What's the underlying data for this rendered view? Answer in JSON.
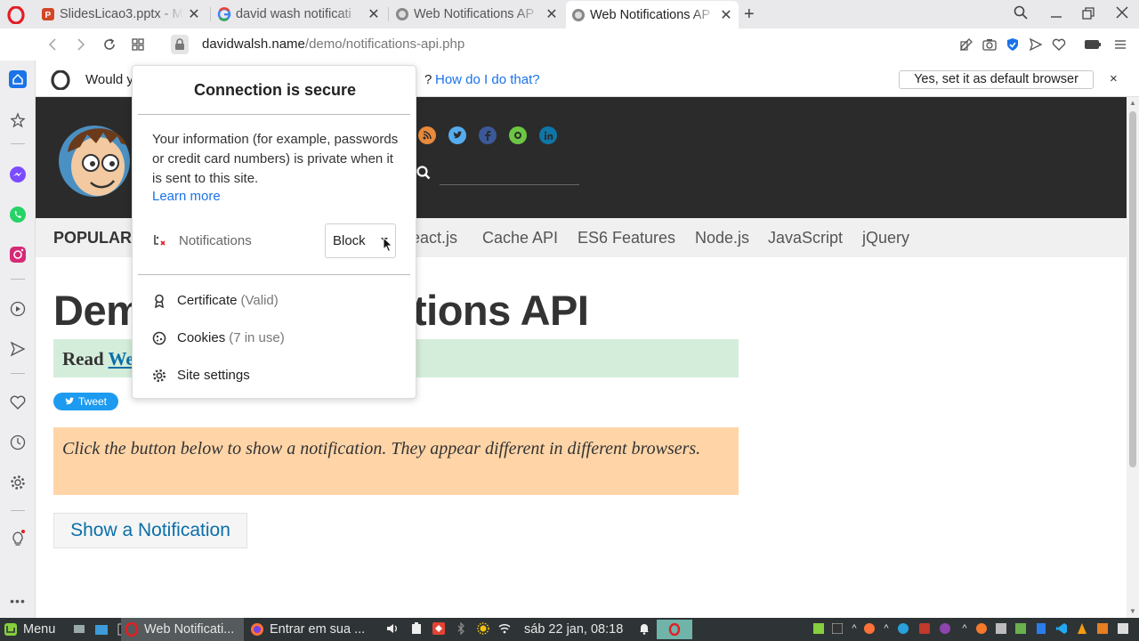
{
  "tabs": [
    {
      "title": "SlidesLicao3.pptx - M",
      "favicon": "powerpoint-icon",
      "active": false
    },
    {
      "title": "david wash notificati",
      "favicon": "google-icon",
      "active": false
    },
    {
      "title": "Web Notifications AP",
      "favicon": "davidwalsh-icon",
      "active": false
    },
    {
      "title": "Web Notifications AP",
      "favicon": "davidwalsh-icon",
      "active": true
    }
  ],
  "tab_close": "✕",
  "new_tab": "+",
  "address": {
    "domain": "davidwalsh.name",
    "path": "/demo/notifications-api.php"
  },
  "banner": {
    "question": "Would y",
    "question_end": "?",
    "how_link": "How do I do that?",
    "yes_button": "Yes, set it as default browser",
    "close": "×"
  },
  "site": {
    "nav_popular": "POPULAR",
    "nav_links": [
      "eact.js",
      "Cache API",
      "ES6 Features",
      "Node.js",
      "JavaScript",
      "jQuery"
    ],
    "title_left": "Dem",
    "title_right": "ations API",
    "read_prefix": "Read ",
    "read_link": "We",
    "tweet_label": "Tweet",
    "info_text": "Click the button below to show a notification. They appear different in different browsers.",
    "show_button": "Show a Notification"
  },
  "popup": {
    "title": "Connection is secure",
    "description": "Your information (for example, passwords or credit card numbers) is private when it is sent to this site.",
    "learn_more": "Learn more",
    "notifications_label": "Notifications",
    "notifications_value": "Block",
    "certificate_label": "Certificate",
    "certificate_status": "(Valid)",
    "cookies_label": "Cookies",
    "cookies_status": "(7 in use)",
    "site_settings_label": "Site settings"
  },
  "taskbar": {
    "menu": "Menu",
    "window_active": "Web Notificati...",
    "window_other": "Entrar em sua ...",
    "clock": "sáb 22 jan, 08:18"
  },
  "colors": {
    "link": "#1a73e8",
    "site_link": "#0a6fa8",
    "header_bg": "#2b2b2b",
    "read_box": "#d4edda",
    "info_box": "#ffd5a8",
    "opera_red": "#e31e24",
    "taskbar_bg": "#2e3436"
  }
}
